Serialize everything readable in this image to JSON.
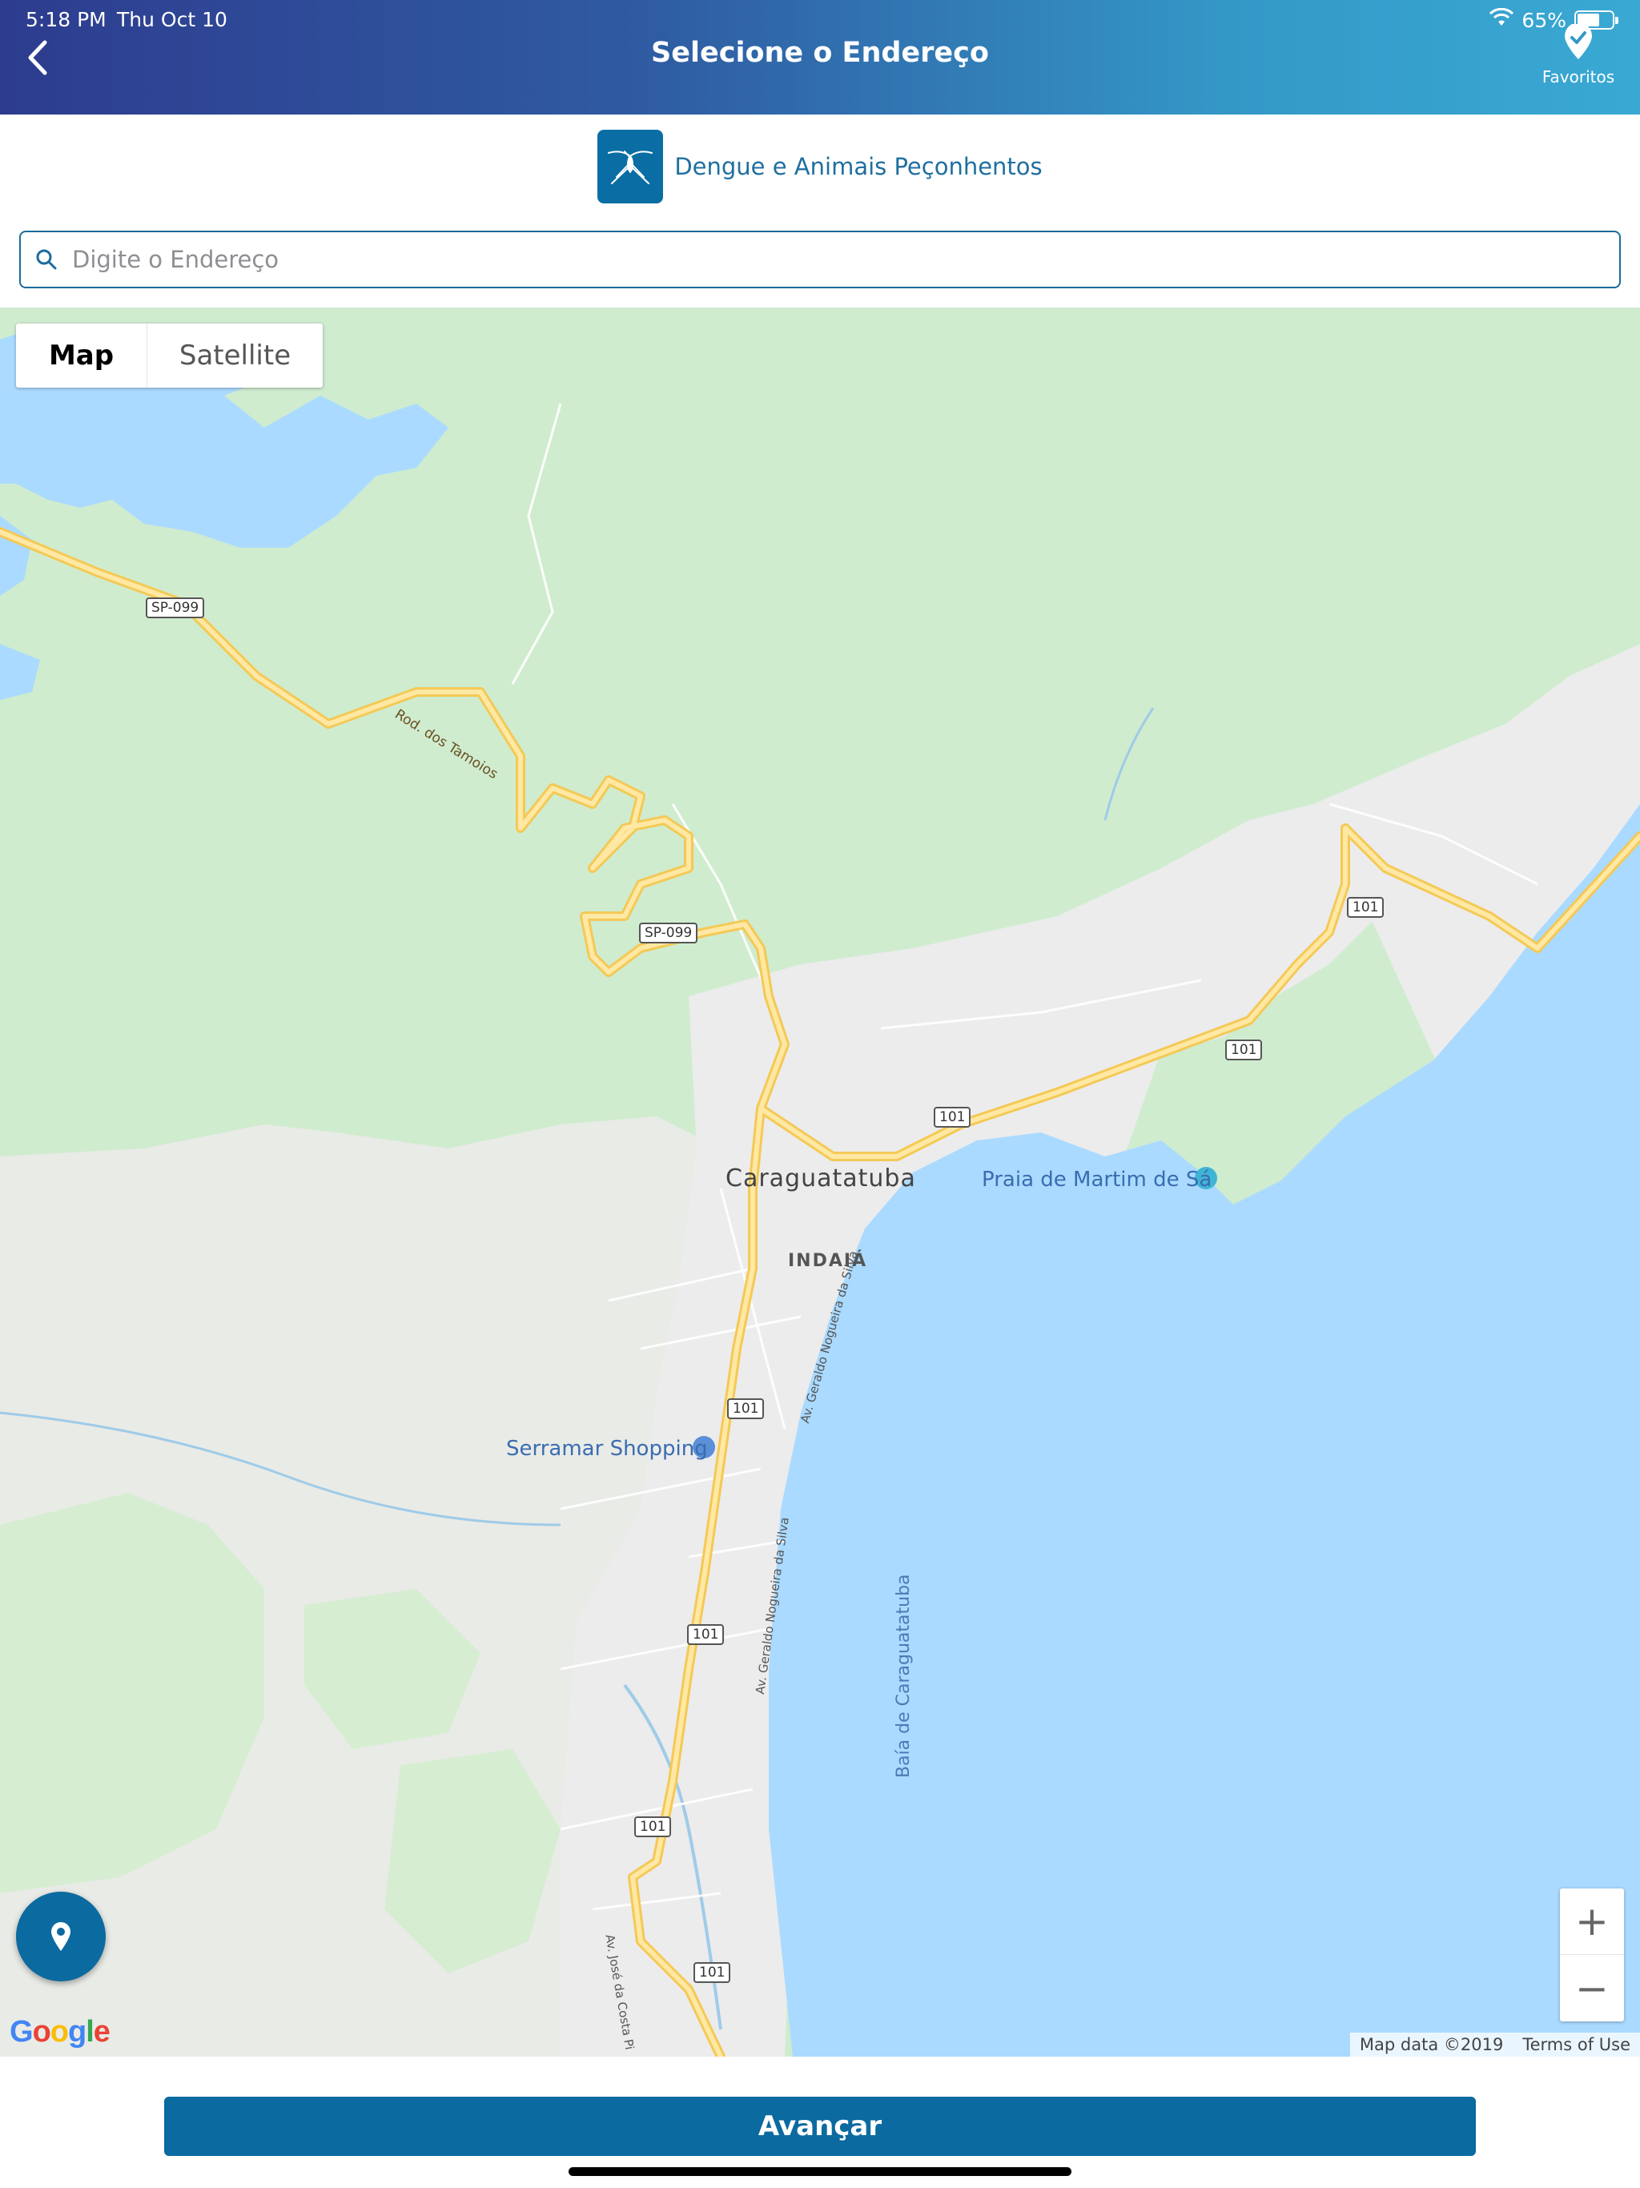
{
  "status": {
    "time": "5:18 PM",
    "date": "Thu Oct 10",
    "battery": "65%",
    "battery_level": 0.65
  },
  "header": {
    "title": "Selecione o Endereço",
    "back_icon": "chevron-left-icon",
    "favorites_label": "Favoritos",
    "favorites_icon": "heart-pin-icon"
  },
  "module": {
    "name": "Dengue e Animais Peçonhentos",
    "icon": "mosquito-icon"
  },
  "search": {
    "placeholder": "Digite o Endereço",
    "value": "",
    "icon": "search-icon"
  },
  "map": {
    "type_control": {
      "map_label": "Map",
      "satellite_label": "Satellite",
      "selected": "Map"
    },
    "labels": {
      "city": "Caraguatatuba",
      "district": "INDAIÁ",
      "beach": "Praia de Martim de Sá",
      "mall": "Serramar Shopping",
      "highway_name": "Rod. dos Tamoios",
      "avenue_1": "Av. Geraldo Nogueira da Silva",
      "avenue_2": "Av. Geraldo Nogueira da Silva",
      "avenue_3": "Av. José da Costa Pi",
      "bay": "Baía de Caraguatatuba"
    },
    "shields": [
      "SP-099",
      "SP-099",
      "101",
      "101",
      "101",
      "101",
      "101",
      "101",
      "101"
    ],
    "zoom_in_label": "+",
    "zoom_out_label": "−",
    "google_logo": "Google",
    "map_data": "Map data ©2019",
    "terms": "Terms of Use",
    "colors": {
      "land": "#cfeccf",
      "urban": "#ececec",
      "water": "#aadaff",
      "highway": "#ffd56a"
    }
  },
  "actions": {
    "next_label": "Avançar"
  },
  "theme": {
    "primary": "#0b6aa0",
    "header_gradient_start": "#2d3c8f",
    "header_gradient_end": "#39a9d3"
  }
}
